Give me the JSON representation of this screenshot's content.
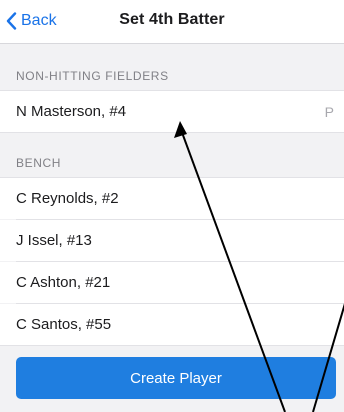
{
  "nav": {
    "back_label": "Back",
    "title": "Set 4th Batter"
  },
  "sections": {
    "fielders": {
      "header": "NON-HITTING FIELDERS",
      "players": [
        {
          "name": "N Masterson, #4",
          "position": "P"
        }
      ]
    },
    "bench": {
      "header": "BENCH",
      "players": [
        {
          "name": "C Reynolds, #2"
        },
        {
          "name": "J Issel, #13"
        },
        {
          "name": "C Ashton, #21"
        },
        {
          "name": "C Santos, #55"
        }
      ]
    }
  },
  "actions": {
    "create_player_label": "Create Player"
  },
  "colors": {
    "accent": "#1a73e8",
    "button": "#1f7ee0",
    "background": "#f2f2f4"
  }
}
